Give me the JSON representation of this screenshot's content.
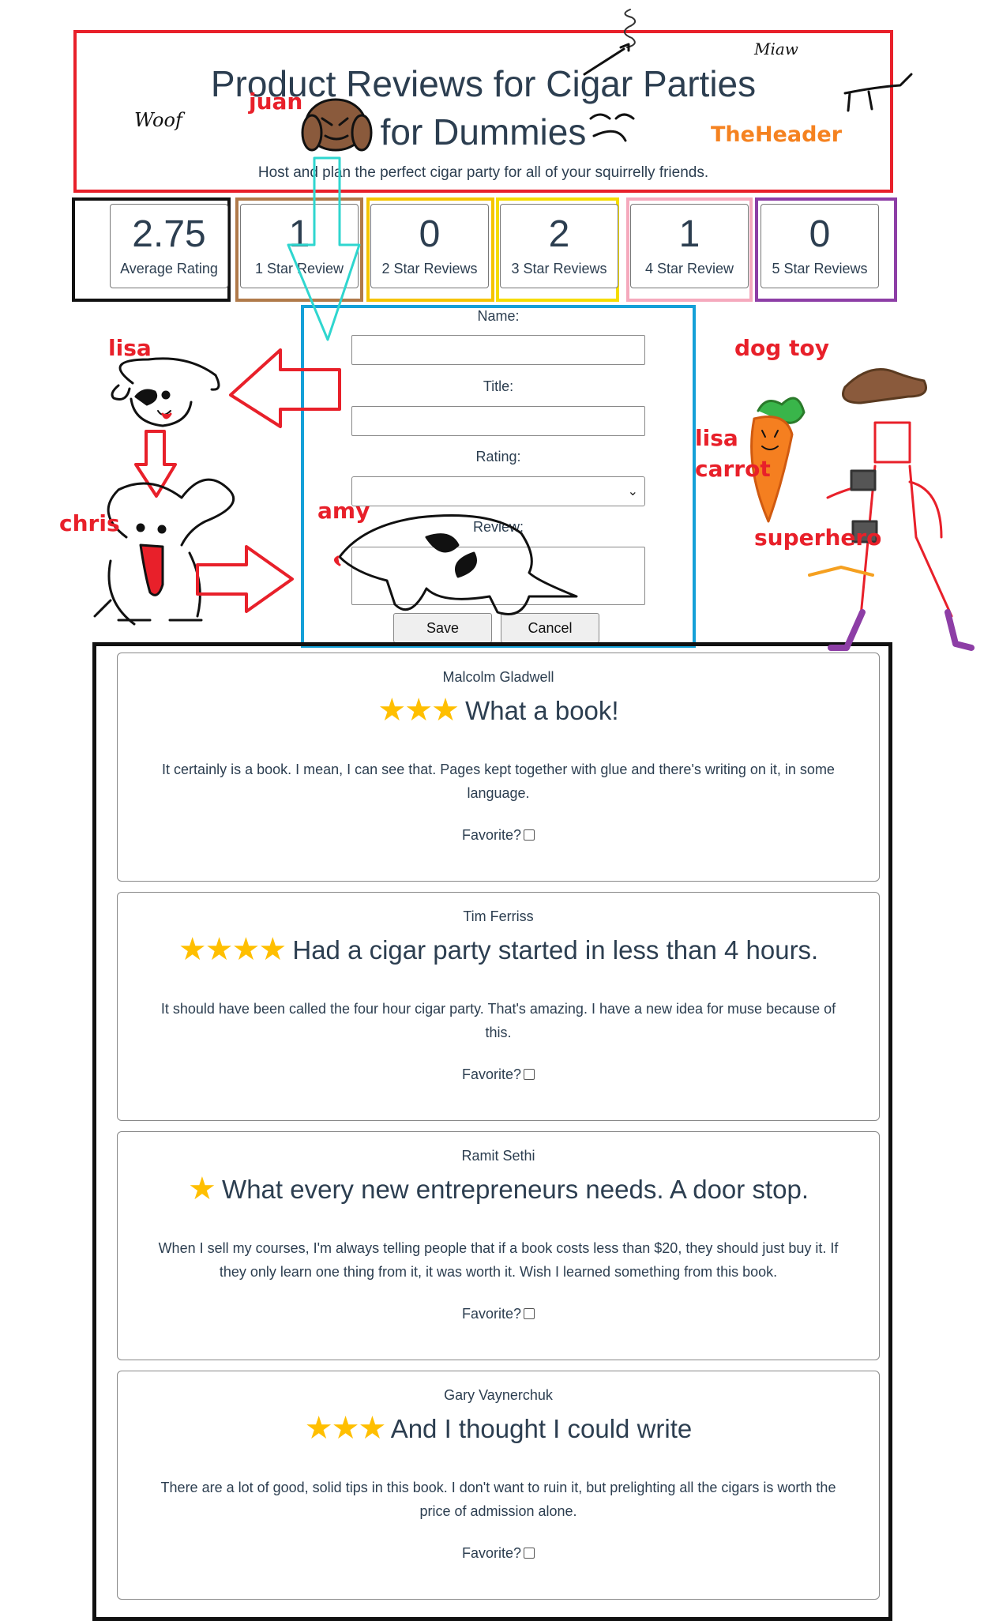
{
  "header": {
    "title": "Product Reviews for Cigar Parties for Dummies",
    "subtitle": "Host and plan the perfect cigar party for all of your squirrelly friends."
  },
  "stats": [
    {
      "value": "2.75",
      "label": "Average Rating"
    },
    {
      "value": "1",
      "label": "1 Star Review"
    },
    {
      "value": "0",
      "label": "2 Star Reviews"
    },
    {
      "value": "2",
      "label": "3 Star Reviews"
    },
    {
      "value": "1",
      "label": "4 Star Review"
    },
    {
      "value": "0",
      "label": "5 Star Reviews"
    }
  ],
  "form": {
    "name_label": "Name:",
    "title_label": "Title:",
    "rating_label": "Rating:",
    "review_label": "Review:",
    "name_value": "",
    "title_value": "",
    "rating_value": "",
    "review_value": "",
    "save_label": "Save",
    "cancel_label": "Cancel"
  },
  "reviews": [
    {
      "author": "Malcolm Gladwell",
      "rating": 3,
      "stars": "★★★",
      "title": "What a book!",
      "body": "It certainly is a book. I mean, I can see that. Pages kept together with glue and there's writing on it, in some language.",
      "favorite_label": "Favorite?",
      "favorite": false
    },
    {
      "author": "Tim Ferriss",
      "rating": 4,
      "stars": "★★★★",
      "title": "Had a cigar party started in less than 4 hours.",
      "body": "It should have been called the four hour cigar party. That's amazing. I have a new idea for muse because of this.",
      "favorite_label": "Favorite?",
      "favorite": false
    },
    {
      "author": "Ramit Sethi",
      "rating": 1,
      "stars": "★",
      "title": "What every new entrepreneurs needs. A door stop.",
      "body": "When I sell my courses, I'm always telling people that if a book costs less than $20, they should just buy it. If they only learn one thing from it, it was worth it. Wish I learned something from this book.",
      "favorite_label": "Favorite?",
      "favorite": false
    },
    {
      "author": "Gary Vaynerchuk",
      "rating": 3,
      "stars": "★★★",
      "title": "And I thought I could write",
      "body": "There are a lot of good, solid tips in this book. I don't want to ruin it, but prelighting all the cigars is worth the price of admission alone.",
      "favorite_label": "Favorite?",
      "favorite": false
    }
  ],
  "annotations": {
    "juan": "juan",
    "woof": "Woof",
    "miaw": "Miaw",
    "the_header": "TheHeader",
    "lisa": "lisa",
    "chris": "chris",
    "amy": "amy",
    "dog_toy": "dog toy",
    "lisa_carrot_1": "lisa",
    "lisa_carrot_2": "carrot",
    "superhero": "superhero"
  },
  "colors": {
    "header_border": "#e8202a",
    "form_border": "#14a0d8",
    "star": "#ffbf00",
    "text": "#2c3e50"
  }
}
